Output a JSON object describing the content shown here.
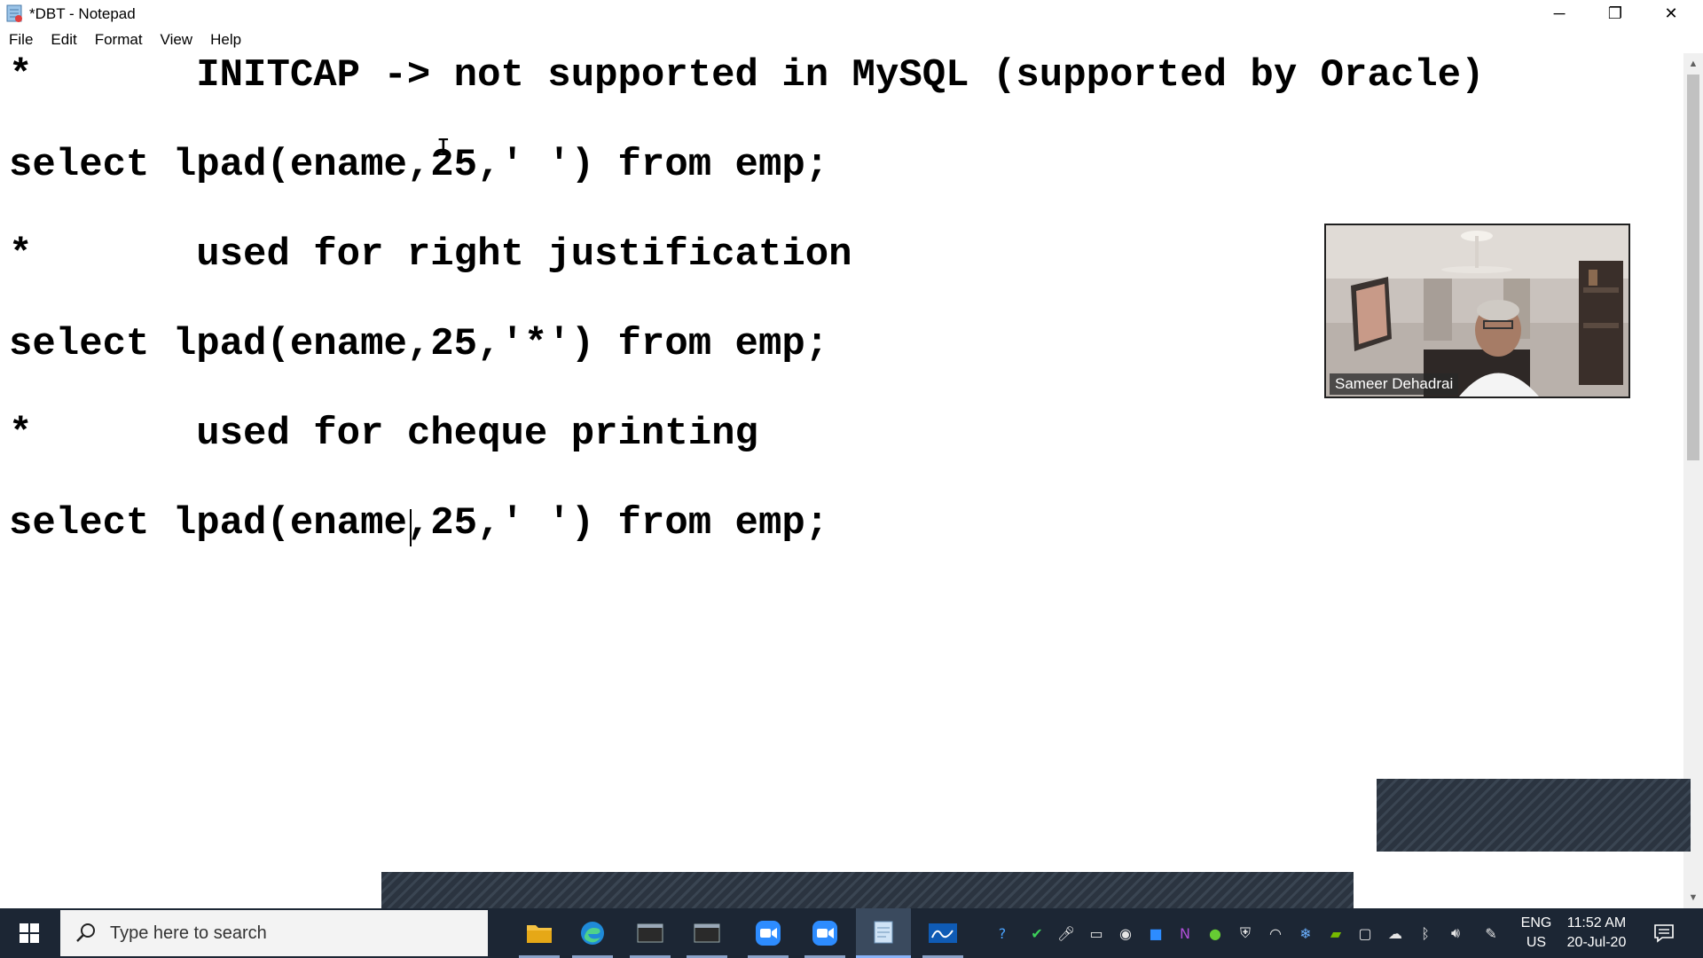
{
  "window": {
    "title": "*DBT - Notepad",
    "min_label": "─",
    "max_label": "❐",
    "close_label": "✕"
  },
  "menu": {
    "items": [
      "File",
      "Edit",
      "Format",
      "View",
      "Help"
    ]
  },
  "editor": {
    "lines": [
      "*       INITCAP -> not supported in MySQL (supported by Oracle)",
      "select lpad(ename,25,' ') from emp;",
      "*       used for right justification",
      "select lpad(ename,25,'*') from emp;",
      "*       used for cheque printing",
      "select lpad(ename,25,' ') from emp;"
    ],
    "mouse_cursor": "I"
  },
  "scrollbar": {
    "up_arrow": "▲",
    "down_arrow": "▼"
  },
  "video": {
    "participant_name": "Sameer Dehadrai"
  },
  "taskbar": {
    "search_placeholder": "Type here to search",
    "pinned": [
      "file-explorer",
      "edge",
      "sql-command-line-1",
      "sql-command-line-2",
      "zoom-1",
      "zoom-2",
      "notepad",
      "whiteboard"
    ],
    "language_top": "ENG",
    "language_bottom": "US",
    "time": "11:52 AM",
    "date": "20-Jul-20"
  },
  "colors": {
    "taskbar_bg": "#1c2634",
    "accent": "#0078d4"
  }
}
